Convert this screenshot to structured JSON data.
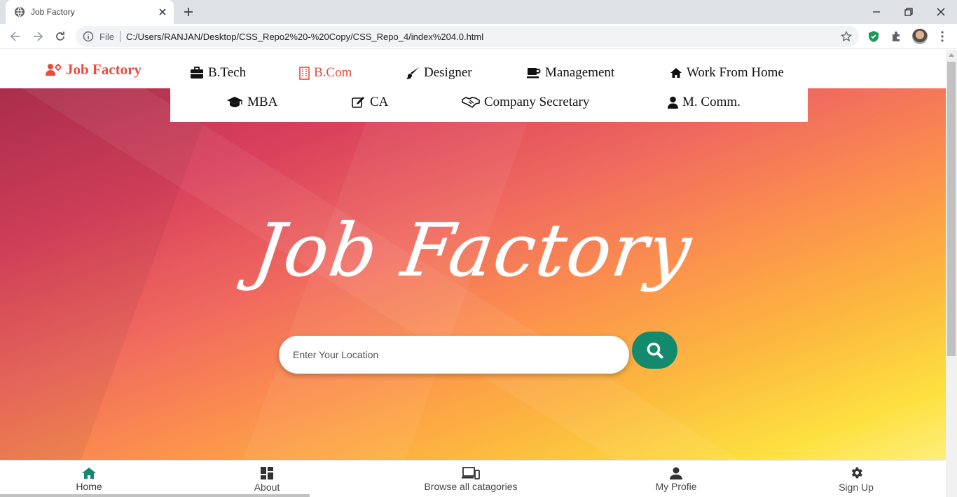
{
  "browser": {
    "tab_title": "Job Factory",
    "file_label": "File",
    "url": "C:/Users/RANJAN/Desktop/CSS_Repo2%20-%20Copy/CSS_Repo_4/index%204.0.html"
  },
  "brand": {
    "label": "Job Factory",
    "icon": "users-cog-icon",
    "color": "#e74c3c"
  },
  "nav": {
    "row1": [
      {
        "label": "B.Tech",
        "icon": "briefcase-icon"
      },
      {
        "label": "B.Com",
        "icon": "building-icon",
        "active": true
      },
      {
        "label": "Designer",
        "icon": "paint-brush-icon"
      },
      {
        "label": "Management",
        "icon": "coffee-icon"
      },
      {
        "label": "Work From Home",
        "icon": "home-icon"
      }
    ],
    "row2": [
      {
        "label": "MBA",
        "icon": "graduation-cap-icon"
      },
      {
        "label": "CA",
        "icon": "edit-icon"
      },
      {
        "label": "Company Secretary",
        "icon": "handshake-icon"
      },
      {
        "label": "M. Comm.",
        "icon": "user-icon"
      }
    ]
  },
  "hero": {
    "title": "Job Factory",
    "search_placeholder": "Enter Your Location",
    "search_button_color": "#138a6e"
  },
  "bottom_nav": [
    {
      "label": "Home",
      "icon": "home-icon",
      "color": "#138a6e"
    },
    {
      "label": "About",
      "icon": "dashboard-icon"
    },
    {
      "label": "Browse all catagories",
      "icon": "devices-icon"
    },
    {
      "label": "My Profie",
      "icon": "person-icon"
    },
    {
      "label": "Sign Up",
      "icon": "settings-icon"
    }
  ]
}
